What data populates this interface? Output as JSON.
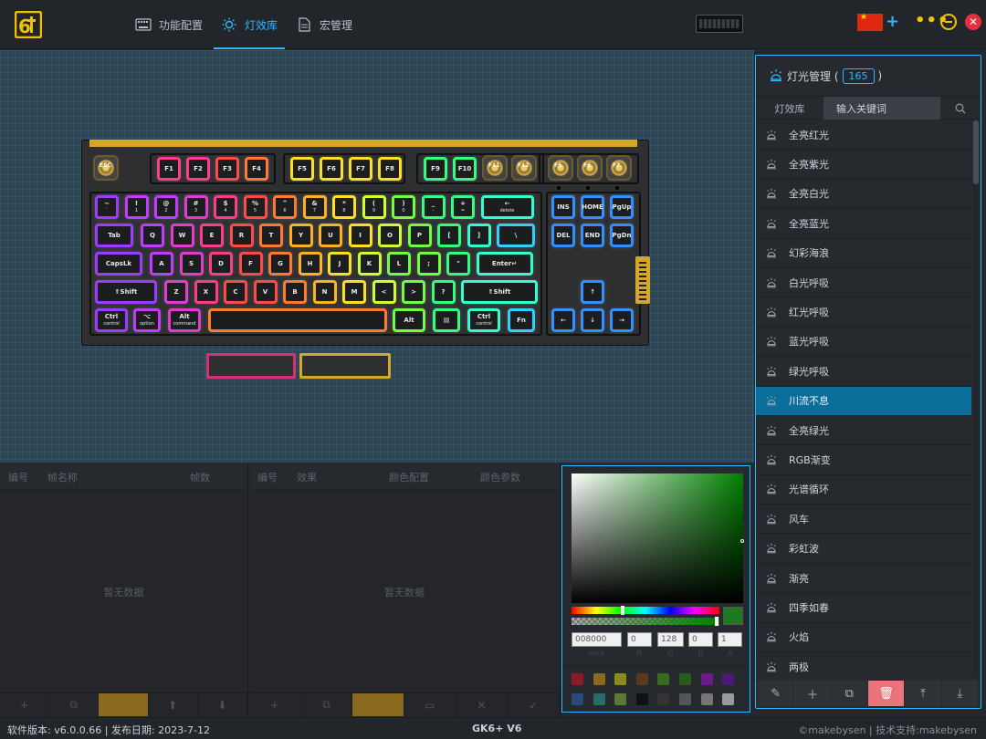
{
  "nav": {
    "items": [
      {
        "label": "功能配置",
        "icon": "keyboard-icon",
        "active": false
      },
      {
        "label": "灯效库",
        "icon": "sun-icon",
        "active": true
      },
      {
        "label": "宏管理",
        "icon": "document-icon",
        "active": false
      }
    ]
  },
  "colors": {
    "accent": "#2fb7ff",
    "gold": "#d4a62c",
    "selected_row": "#0b6e9a",
    "danger": "#e9747a",
    "close": "#e5303b"
  },
  "keyboard": {
    "fn_row": [
      "ESC",
      "F1",
      "F2",
      "F3",
      "F4",
      "F5",
      "F6",
      "F7",
      "F8",
      "F9",
      "F10",
      "F11",
      "F12",
      "F5",
      "F6",
      "F7"
    ],
    "row1": [
      {
        "top": "~",
        "bottom": "`"
      },
      {
        "top": "!",
        "bottom": "1"
      },
      {
        "top": "@",
        "bottom": "2"
      },
      {
        "top": "#",
        "bottom": "3"
      },
      {
        "top": "$",
        "bottom": "4"
      },
      {
        "top": "%",
        "bottom": "5"
      },
      {
        "top": "^",
        "bottom": "6"
      },
      {
        "top": "&",
        "bottom": "7"
      },
      {
        "top": "*",
        "bottom": "8"
      },
      {
        "top": "(",
        "bottom": "9"
      },
      {
        "top": ")",
        "bottom": "0"
      },
      {
        "top": "_",
        "bottom": "-"
      },
      {
        "top": "+",
        "bottom": "="
      },
      {
        "top": "←",
        "bottom": "delete"
      }
    ],
    "row2": [
      "Tab",
      "Q",
      "W",
      "E",
      "R",
      "T",
      "Y",
      "U",
      "I",
      "O",
      "P",
      "[",
      "]",
      "\\"
    ],
    "row3": [
      "CapsLk",
      "A",
      "S",
      "D",
      "F",
      "G",
      "H",
      "J",
      "K",
      "L",
      ";",
      "\"",
      "Enter↵"
    ],
    "row4": [
      "⇑Shift",
      "Z",
      "X",
      "C",
      "V",
      "B",
      "N",
      "M",
      "<",
      ">",
      "?",
      "⇑Shift"
    ],
    "row5": [
      {
        "top": "Ctrl",
        "bottom": "control"
      },
      {
        "top": "⌥",
        "bottom": "option"
      },
      {
        "top": "Alt",
        "bottom": "command"
      },
      {
        "top": "",
        "bottom": ""
      },
      {
        "top": "Alt",
        "bottom": ""
      },
      {
        "top": "▤",
        "bottom": ""
      },
      {
        "top": "Ctrl",
        "bottom": "control"
      },
      {
        "top": "Fn",
        "bottom": ""
      }
    ],
    "nav_cluster": [
      "INS",
      "HOME",
      "PgUp",
      "DEL",
      "END",
      "PgDn"
    ],
    "arrows": [
      "↑",
      "←",
      "↓",
      "→"
    ]
  },
  "light_panel": {
    "title": "灯光管理 (",
    "count": "165",
    "title_close": ")",
    "tab_library": "灯效库",
    "search_placeholder": "输入关键词",
    "items": [
      "全亮红光",
      "全亮紫光",
      "全亮白光",
      "全亮蓝光",
      "幻彩海浪",
      "白光呼吸",
      "红光呼吸",
      "蓝光呼吸",
      "绿光呼吸",
      "川流不息",
      "全亮绿光",
      "RGB渐变",
      "光谱循环",
      "风车",
      "彩虹波",
      "渐亮",
      "四季如春",
      "火焰",
      "两极"
    ],
    "selected": "川流不息",
    "toolbar": [
      "edit-icon",
      "plus-icon",
      "copy-icon",
      "delete-icon",
      "upload-icon",
      "download-icon"
    ]
  },
  "frames_pane": {
    "headers": [
      "编号",
      "帧名称",
      "帧数"
    ],
    "empty": "暂无数据",
    "buttons": [
      "+",
      "⧉",
      "",
      "⬆",
      "⬇"
    ]
  },
  "effects_pane": {
    "headers": [
      "编号",
      "效果",
      "颜色配置",
      "颜色参数"
    ],
    "empty": "暂无数据",
    "buttons": [
      "+",
      "⧉",
      "",
      "▭",
      "✕",
      "✓"
    ]
  },
  "color_picker": {
    "hex": "008000",
    "r": "0",
    "g": "128",
    "b": "0",
    "a": "1",
    "labels": [
      "Hex",
      "R",
      "G",
      "B",
      "A"
    ],
    "current": "#008000",
    "swatches": [
      "#8b1a2a",
      "#8a6a1e",
      "#8a8a1e",
      "#5a3a1e",
      "#3a6a1e",
      "#2a5a1e",
      "#6a1a8a",
      "#4a1a7a",
      "#2a4a7a",
      "#2a6a6a",
      "#5a7a3a",
      "#111111",
      "#333333",
      "#555555",
      "#777777",
      "#999999"
    ]
  },
  "status": {
    "version": "软件版本: v6.0.0.66 | 发布日期: 2023-7-12",
    "model": "GK6+ V6",
    "credit": "©makebysen | 技术支持:makebysen"
  }
}
